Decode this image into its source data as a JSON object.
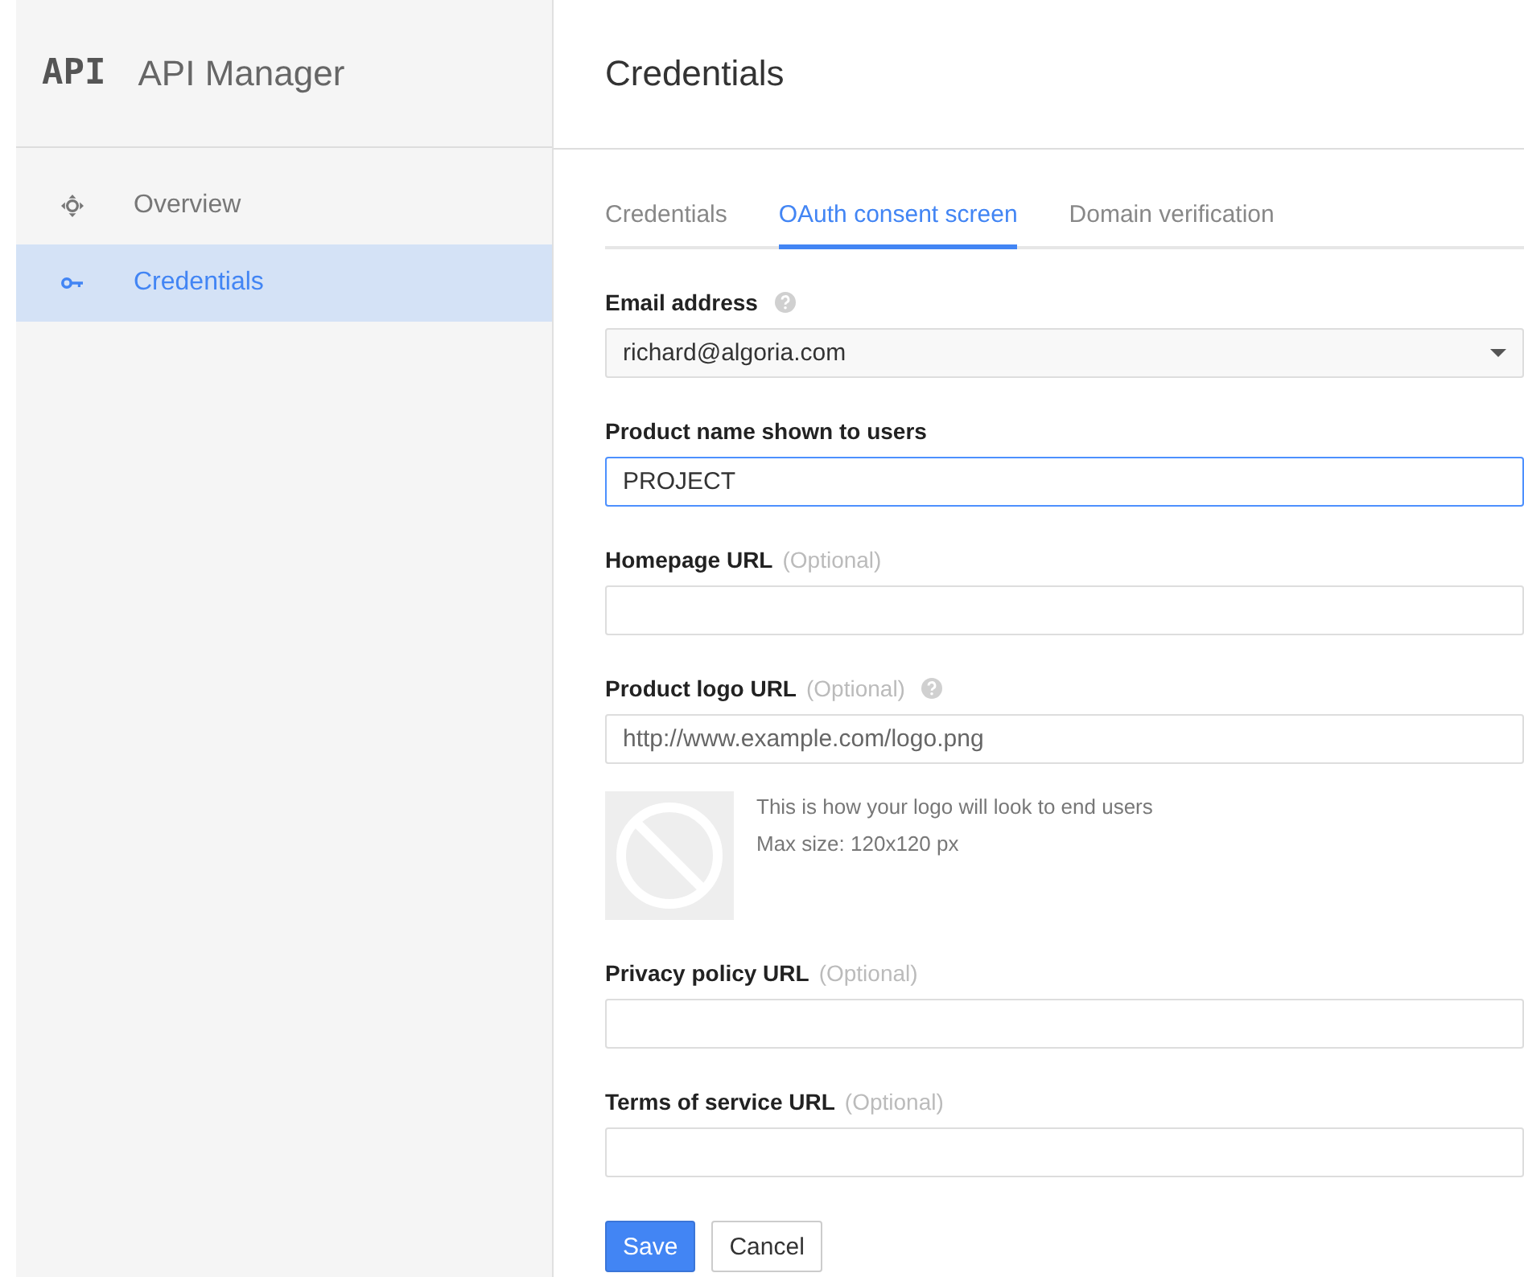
{
  "sidebar": {
    "logo": "API",
    "title": "API Manager",
    "items": [
      {
        "label": "Overview",
        "selected": false
      },
      {
        "label": "Credentials",
        "selected": true
      }
    ]
  },
  "page": {
    "title": "Credentials"
  },
  "tabs": [
    {
      "label": "Credentials",
      "selected": false
    },
    {
      "label": "OAuth consent screen",
      "selected": true
    },
    {
      "label": "Domain verification",
      "selected": false
    }
  ],
  "fields": [
    {
      "kind": "select",
      "label": "Email address",
      "help": true,
      "value": "richard@algoria.com",
      "focused": false
    },
    {
      "kind": "text",
      "label": "Product name shown to users",
      "help": false,
      "value": "PROJECT",
      "focused": true
    },
    {
      "kind": "text",
      "label": "Homepage URL",
      "optional": "(Optional)",
      "help": false,
      "focused": false
    },
    {
      "kind": "text",
      "label": "Product logo URL",
      "optional": "(Optional)",
      "help": true,
      "placeholder": "http://www.example.com/logo.png",
      "focused": false,
      "preview": [
        "This is how your logo will look to end users",
        "Max size: 120x120 px"
      ]
    },
    {
      "kind": "text",
      "label": "Privacy policy URL",
      "optional": "(Optional)",
      "help": false,
      "focused": false
    },
    {
      "kind": "text",
      "label": "Terms of service URL",
      "optional": "(Optional)",
      "help": false,
      "focused": false
    }
  ],
  "buttons": [
    {
      "label": "Save",
      "kind": "primary"
    },
    {
      "label": "Cancel",
      "kind": "secondary"
    }
  ]
}
